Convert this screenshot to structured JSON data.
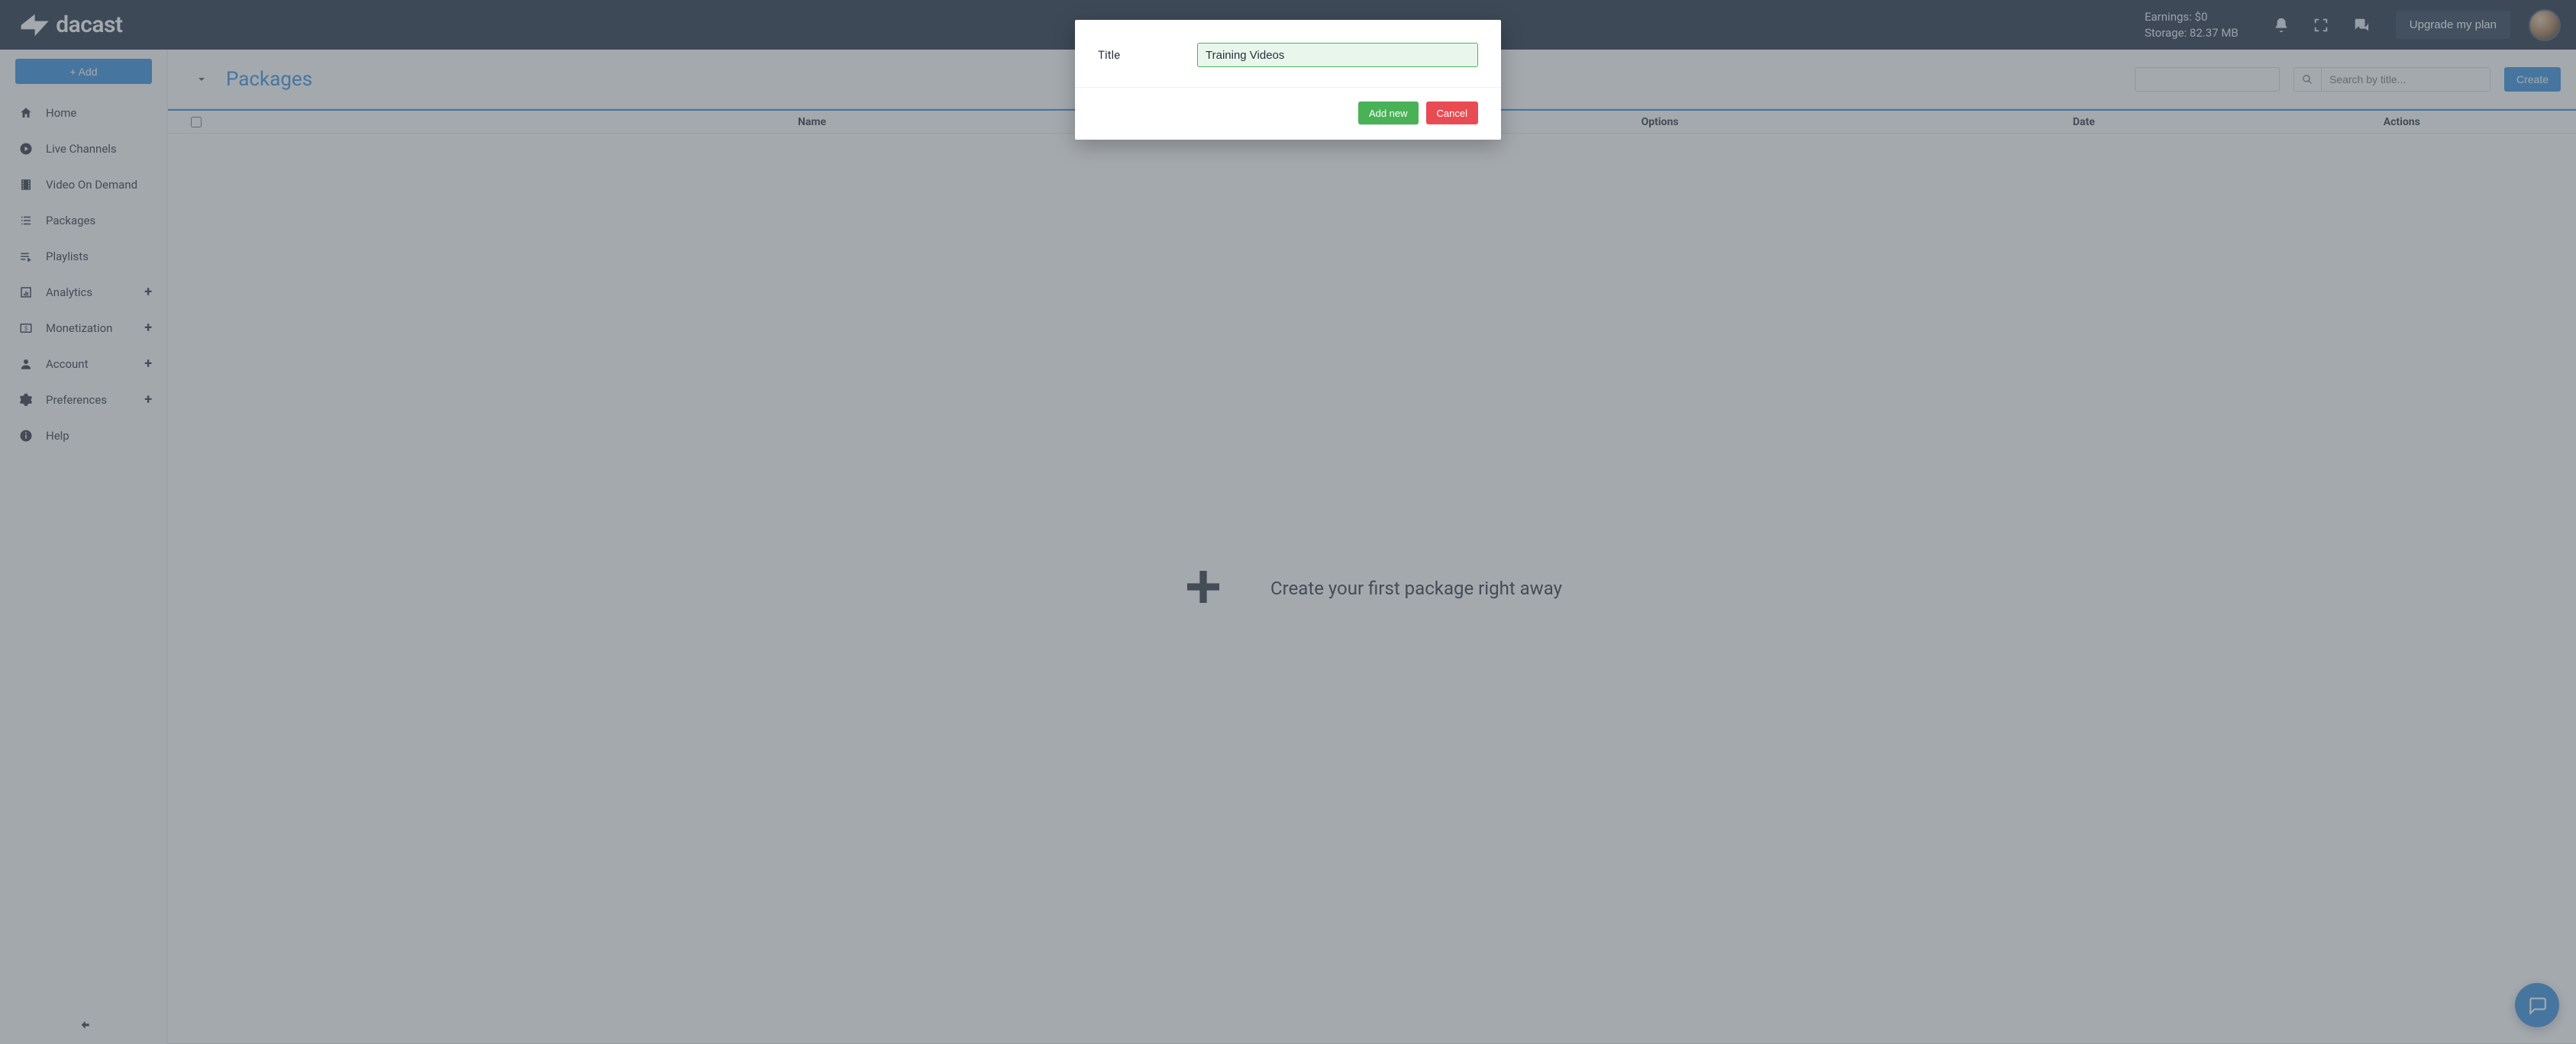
{
  "brand": {
    "name": "dacast"
  },
  "header": {
    "earnings_label": "Earnings:",
    "earnings_value": "$0",
    "storage_label": "Storage:",
    "storage_value": "82.37 MB",
    "upgrade_label": "Upgrade my plan"
  },
  "sidebar": {
    "add_label": "+ Add",
    "items": [
      {
        "label": "Home"
      },
      {
        "label": "Live Channels"
      },
      {
        "label": "Video On Demand"
      },
      {
        "label": "Packages"
      },
      {
        "label": "Playlists"
      },
      {
        "label": "Analytics",
        "expandable": true
      },
      {
        "label": "Monetization",
        "expandable": true
      },
      {
        "label": "Account",
        "expandable": true
      },
      {
        "label": "Preferences",
        "expandable": true
      },
      {
        "label": "Help"
      }
    ]
  },
  "toolbar": {
    "page_title": "Packages",
    "search_placeholder": "Search by title...",
    "create_label": "Create"
  },
  "table": {
    "columns": {
      "name": "Name",
      "options": "Options",
      "date": "Date",
      "actions": "Actions"
    }
  },
  "empty": {
    "message": "Create your first package right away"
  },
  "modal": {
    "title_label": "Title",
    "title_value": "Training Videos",
    "addnew_label": "Add new",
    "cancel_label": "Cancel"
  }
}
